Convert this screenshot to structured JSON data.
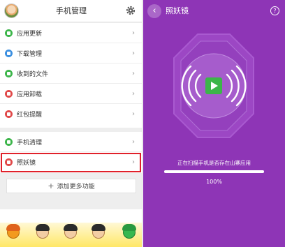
{
  "header": {
    "title": "手机管理"
  },
  "menu_group_1": [
    {
      "label": "应用更新",
      "icon": "update-icon",
      "color": "#3cb54a"
    },
    {
      "label": "下载管理",
      "icon": "download-icon",
      "color": "#3b8fe0"
    },
    {
      "label": "收到的文件",
      "icon": "folder-icon",
      "color": "#3cb54a"
    },
    {
      "label": "应用卸载",
      "icon": "uninstall-icon",
      "color": "#e04848"
    },
    {
      "label": "红包提醒",
      "icon": "red-packet-icon",
      "color": "#e04848"
    }
  ],
  "menu_group_2": [
    {
      "label": "手机清理",
      "icon": "clean-icon",
      "color": "#3cb54a"
    },
    {
      "label": "照妖镜",
      "icon": "mirror-icon",
      "color": "#e04848"
    }
  ],
  "add_more": {
    "label": "添加更多功能",
    "icon": "plus-icon"
  },
  "right_panel": {
    "title": "照妖镜",
    "back_icon": "back-icon",
    "help_icon": "help-icon",
    "scan_text": "正在扫描手机是否存在山寨应用",
    "progress": 1.0,
    "progress_label": "100%",
    "accent": "#8e35b6",
    "play_color": "#3cb54a"
  }
}
